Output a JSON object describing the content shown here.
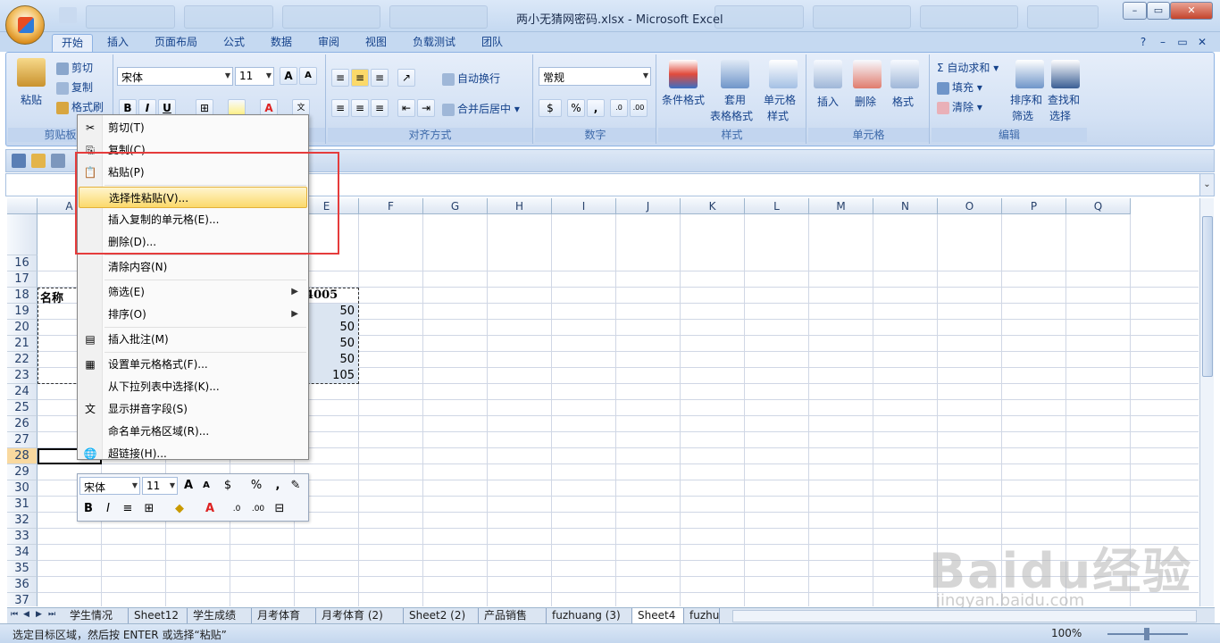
{
  "window": {
    "title": "两小无猜网密码.xlsx - Microsoft Excel",
    "controls": [
      "–",
      "▭",
      "✕"
    ]
  },
  "ribbon_tabs": [
    "开始",
    "插入",
    "页面布局",
    "公式",
    "数据",
    "审阅",
    "视图",
    "负载测试",
    "团队"
  ],
  "ribbon": {
    "clipboard": {
      "label": "剪贴板",
      "paste": "粘贴",
      "cut": "剪切",
      "copy": "复制",
      "format_painter": "格式刷"
    },
    "font": {
      "label": "字体",
      "font_name": "宋体",
      "font_size": "11",
      "bold": "B",
      "italic": "I",
      "underline": "U"
    },
    "alignment": {
      "label": "对齐方式",
      "wrap": "自动换行",
      "merge": "合并后居中"
    },
    "number": {
      "label": "数字",
      "format": "常规",
      "percent": "%",
      "comma": ","
    },
    "styles": {
      "label": "样式",
      "conditional": "条件格式",
      "table1": "套用",
      "table2": "表格格式",
      "cellstyle1": "单元格",
      "cellstyle2": "样式"
    },
    "cells": {
      "label": "单元格",
      "insert": "插入",
      "delete": "删除",
      "format": "格式"
    },
    "editing": {
      "label": "编辑",
      "autosum": "自动求和",
      "fill": "填充",
      "clear": "清除",
      "sort1": "排序和",
      "sort2": "筛选",
      "find1": "查找和",
      "find2": "选择"
    }
  },
  "columns": [
    "A",
    "B",
    "C",
    "D",
    "E",
    "F",
    "G",
    "H",
    "I",
    "J",
    "K",
    "L",
    "M",
    "N",
    "O",
    "P",
    "Q"
  ],
  "rows": [
    "16",
    "17",
    "18",
    "19",
    "20",
    "21",
    "22",
    "23",
    "24",
    "25",
    "26",
    "27",
    "28",
    "29",
    "30",
    "31",
    "32",
    "33",
    "34",
    "35",
    "36",
    "37"
  ],
  "cells": {
    "a18": "名称",
    "e18": "04005",
    "e19": "50",
    "e20": "50",
    "e21": "50",
    "e22": "50",
    "e23": "105"
  },
  "context_menu": [
    {
      "label": "剪切(T)",
      "icon": "cut-icon"
    },
    {
      "label": "复制(C)",
      "icon": "copy-icon"
    },
    {
      "label": "粘贴(P)",
      "icon": "paste-icon"
    },
    {
      "label": "选择性粘贴(V)...",
      "icon": "",
      "highlighted": true
    },
    {
      "label": "插入复制的单元格(E)...",
      "icon": ""
    },
    {
      "label": "删除(D)...",
      "icon": ""
    },
    {
      "label": "清除内容(N)",
      "icon": ""
    },
    {
      "label": "筛选(E)",
      "icon": "",
      "submenu": true
    },
    {
      "label": "排序(O)",
      "icon": "",
      "submenu": true
    },
    {
      "label": "插入批注(M)",
      "icon": "comment-icon"
    },
    {
      "label": "设置单元格格式(F)...",
      "icon": "format-cells-icon"
    },
    {
      "label": "从下拉列表中选择(K)...",
      "icon": ""
    },
    {
      "label": "显示拼音字段(S)",
      "icon": "phonetic-icon"
    },
    {
      "label": "命名单元格区域(R)...",
      "icon": ""
    },
    {
      "label": "超链接(H)...",
      "icon": "hyperlink-icon"
    }
  ],
  "mini_toolbar": {
    "font_name": "宋体",
    "font_size": "11"
  },
  "sheet_tabs": [
    "学生情况",
    "Sheet12",
    "学生成绩",
    "月考体育",
    "月考体育 (2)",
    "Sheet2 (2)",
    "产品销售",
    "fuzhuang (3)",
    "Sheet4",
    "fuzhu"
  ],
  "active_sheet": "Sheet4",
  "status": {
    "text": "选定目标区域，然后按 ENTER 或选择“粘贴”",
    "zoom": "100%"
  },
  "watermark": {
    "main": "Baidu经验",
    "sub": "jingyan.baidu.com"
  }
}
